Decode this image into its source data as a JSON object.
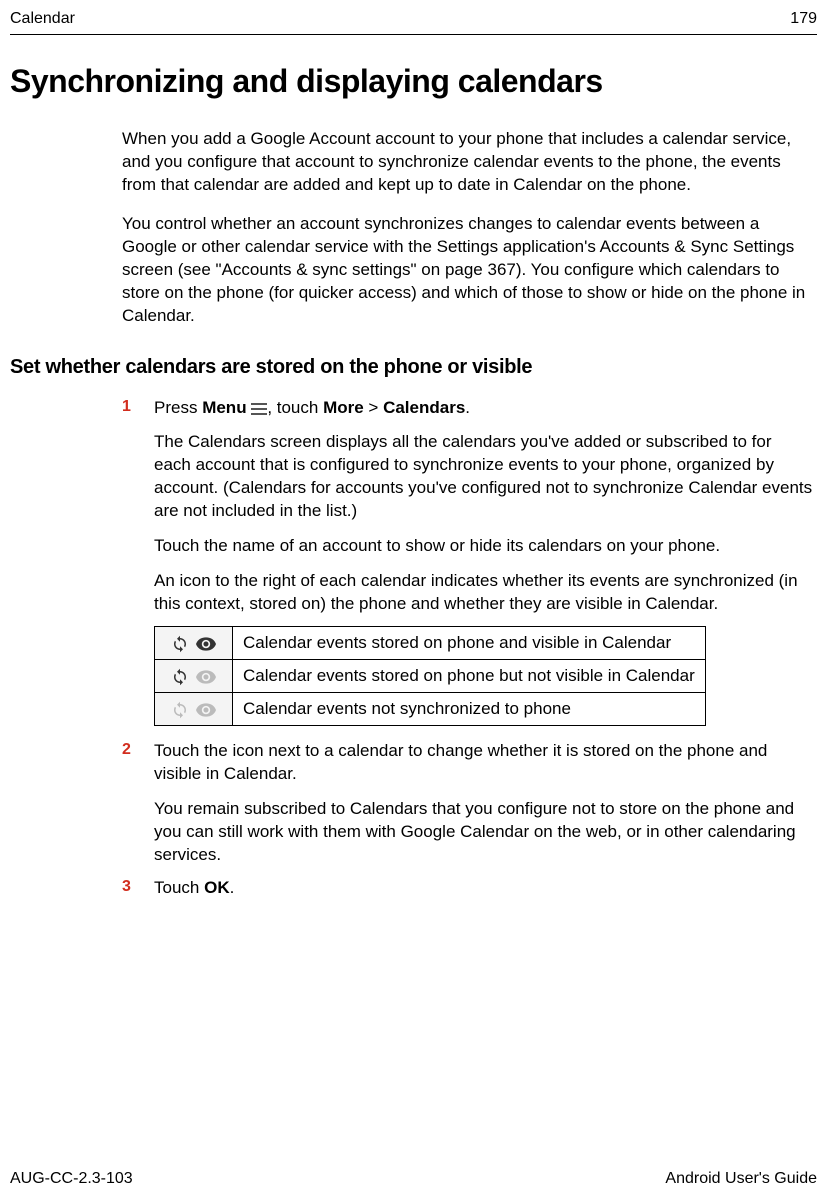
{
  "header": {
    "left": "Calendar",
    "right": "179"
  },
  "title": "Synchronizing and displaying calendars",
  "intro1": "When you add a Google Account account to your phone that includes a calendar service, and you configure that account to synchronize calendar events to the phone, the events from that calendar are added and kept up to date in Calendar on the phone.",
  "intro2": "You control whether an account synchronizes changes to calendar events between a Google or other calendar service with the Settings application's Accounts & Sync Settings screen (see \"Accounts & sync settings\" on page 367). You configure which calendars to store on the phone (for quicker access) and which of those to show or hide on the phone in Calendar.",
  "subheading": "Set whether calendars are stored on the phone or visible",
  "step1": {
    "num": "1",
    "press": "Press ",
    "menu": "Menu",
    "touch": ", touch ",
    "more": "More",
    "gt": " > ",
    "calendars": "Calendars",
    "period": ".",
    "p2": "The Calendars screen displays all the calendars you've added or subscribed to for each account that is configured to synchronize events to your phone, organized by account. (Calendars for accounts you've configured not to synchronize Calendar events are not included in the list.)",
    "p3": "Touch the name of an account to show or hide its calendars on your phone.",
    "p4": "An icon to the right of each calendar indicates whether its events are synchronized (in this context, stored on) the phone and whether they are visible in Calendar."
  },
  "table": {
    "row1": "Calendar events stored on phone and visible in Calendar",
    "row2": "Calendar events stored on phone but not visible in Calendar",
    "row3": "Calendar events not synchronized to phone"
  },
  "step2": {
    "num": "2",
    "p1": "Touch the icon next to a calendar to change whether it is stored on the phone and visible in Calendar.",
    "p2": "You remain subscribed to Calendars that you configure not to store on the phone and you can still work with them with Google Calendar on the web, or in other calendaring services."
  },
  "step3": {
    "num": "3",
    "touch": "Touch ",
    "ok": "OK",
    "period": "."
  },
  "footer": {
    "left": "AUG-CC-2.3-103",
    "right": "Android User's Guide"
  }
}
